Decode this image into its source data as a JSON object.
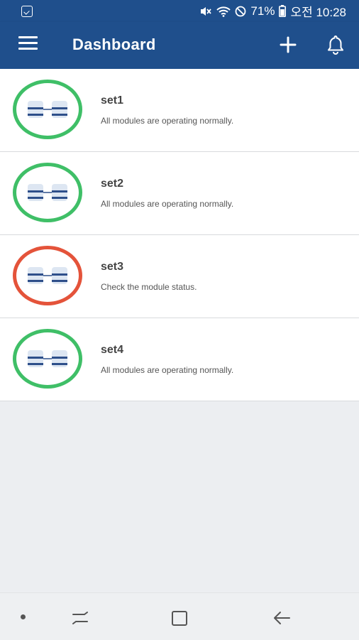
{
  "status_bar": {
    "battery": "71%",
    "time": "오전 10:28",
    "icons": [
      "gallery-save-icon",
      "mute-icon",
      "wifi-icon",
      "do-not-disturb-icon",
      "battery-icon"
    ]
  },
  "app_bar": {
    "title": "Dashboard",
    "icons": [
      "menu-icon",
      "plus-icon",
      "bell-icon"
    ]
  },
  "sets": [
    {
      "name": "set1",
      "status": "All modules are operating normally.",
      "state": "ok"
    },
    {
      "name": "set2",
      "status": "All modules are operating normally.",
      "state": "ok"
    },
    {
      "name": "set3",
      "status": "Check the module status.",
      "state": "warning"
    },
    {
      "name": "set4",
      "status": "All modules are operating normally.",
      "state": "ok"
    }
  ],
  "colors": {
    "primary": "#1f4f8c",
    "ok": "#3fbf67",
    "warning": "#e4533a",
    "background": "#eceef1"
  },
  "nav_bar": {
    "icons": [
      "dot-icon",
      "recent-apps-icon",
      "home-icon",
      "back-icon"
    ]
  }
}
